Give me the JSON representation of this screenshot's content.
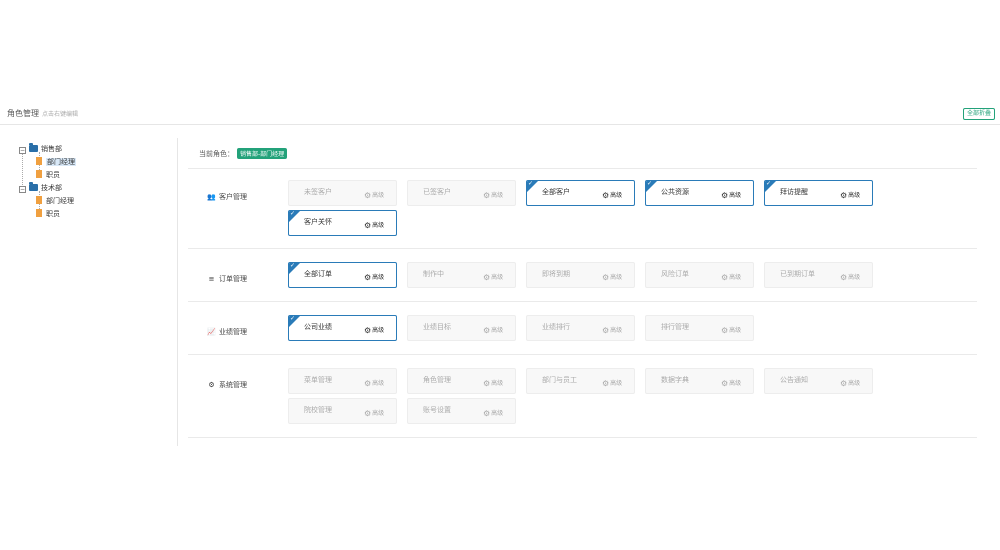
{
  "header": {
    "title": "角色管理",
    "hint": "点击右键编辑",
    "save_all": "全部折叠"
  },
  "tree": [
    {
      "toggle": "−",
      "label": "销售部",
      "children": [
        "部门经理",
        "职员"
      ]
    },
    {
      "toggle": "−",
      "label": "技术部",
      "children": [
        "部门经理",
        "职员"
      ]
    }
  ],
  "role": {
    "label": "当前角色：",
    "value": "销售部-部门经理"
  },
  "advanced_label": "高级",
  "sections": [
    {
      "icon": "👥",
      "label": "客户管理",
      "items": [
        {
          "name": "未签客户",
          "on": false
        },
        {
          "name": "已签客户",
          "on": false
        },
        {
          "name": "全部客户",
          "on": true
        },
        {
          "name": "公共资源",
          "on": true
        },
        {
          "name": "拜访提醒",
          "on": true
        },
        {
          "name": "客户关怀",
          "on": true
        }
      ]
    },
    {
      "icon": "≡",
      "label": "订单管理",
      "items": [
        {
          "name": "全部订单",
          "on": true
        },
        {
          "name": "制作中",
          "on": false
        },
        {
          "name": "即将到期",
          "on": false
        },
        {
          "name": "风险订单",
          "on": false
        },
        {
          "name": "已到期订单",
          "on": false
        }
      ]
    },
    {
      "icon": "📈",
      "label": "业绩管理",
      "items": [
        {
          "name": "公司业绩",
          "on": true
        },
        {
          "name": "业绩目标",
          "on": false
        },
        {
          "name": "业绩排行",
          "on": false
        },
        {
          "name": "排行管理",
          "on": false
        }
      ]
    },
    {
      "icon": "⚙",
      "label": "系统管理",
      "items": [
        {
          "name": "菜单管理",
          "on": false
        },
        {
          "name": "角色管理",
          "on": false
        },
        {
          "name": "部门与员工",
          "on": false
        },
        {
          "name": "数据字典",
          "on": false
        },
        {
          "name": "公告通知",
          "on": false
        },
        {
          "name": "院校管理",
          "on": false
        },
        {
          "name": "账号设置",
          "on": false
        }
      ]
    }
  ]
}
